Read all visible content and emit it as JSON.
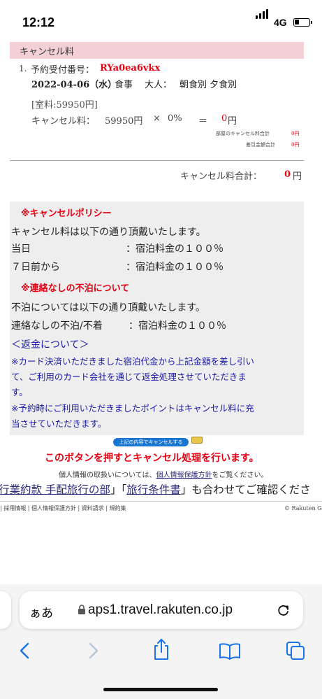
{
  "status_bar": {
    "time": "12:12",
    "network": "4G"
  },
  "section": {
    "header": "キャンセル料"
  },
  "reservation": {
    "number_prefix": "1.",
    "number_label": "予約受付番号：",
    "number_value": "RYa0ea6vkx",
    "date": "2022-04-06（水）",
    "meal_label": "食事",
    "adult_label": "大人：",
    "meals": "朝食別 夕食別",
    "room_fee": "[室料:59950円]",
    "cancel_fee_label": "キャンセル料：",
    "base_amount": "59950円",
    "times": "×",
    "rate": "0%",
    "equals": "＝",
    "result_value": "0",
    "result_unit": "円",
    "room_total_label": "部屋のキャンセル料合計",
    "room_total_value": "0円",
    "deduction_label": "差引金額合計",
    "deduction_value": "0円"
  },
  "total": {
    "label": "キャンセル料合計：",
    "value": "0",
    "unit": "円"
  },
  "policy": {
    "title": "※キャンセルポリシー",
    "intro": "キャンセル料は以下の通り頂戴いたします。",
    "row1_label": "当日",
    "row1_value": "：宿泊料金の１００％",
    "row2_label": "７日前から",
    "row2_value": "：宿泊料金の１００％",
    "noshow_title": "※連絡なしの不泊について",
    "noshow_intro": "不泊については以下の通り頂戴いたします。",
    "noshow_label": "連絡なしの不泊/不着",
    "noshow_value": "：宿泊料金の１００％",
    "refund_title": "＜返金について＞",
    "refund_line1": "※カード決済いただきました宿泊代金から上記金額を差し引い",
    "refund_line2": "て、ご利用のカード会社を通じて返金処理させていただきま",
    "refund_line3": "す。",
    "refund_line4": "※予約時にご利用いただきましたポイントはキャンセル料に充",
    "refund_line5": "当させていただきます。"
  },
  "cancel_button": {
    "label": "上記の内容でキャンセルする"
  },
  "notice": "このボタンを押すとキャンセル処理を行います。",
  "privacy": {
    "prefix": "個人情報の取扱いについては、",
    "link": "個人情報保護方針",
    "suffix": "をご覧ください。"
  },
  "terms": {
    "part1": "行業約款 手配旅行の部",
    "part2": "」「",
    "part3": "旅行条件書",
    "part4": "」も合わせてご確認くださ"
  },
  "footer": {
    "links": "| 採用情報 | 個人情報保護方針 | 資料請求 | 規約集",
    "copyright": "© Rakuten Gro"
  },
  "browser": {
    "aa_label": "ぁあ",
    "url": "aps1.travel.rakuten.co.jp"
  }
}
